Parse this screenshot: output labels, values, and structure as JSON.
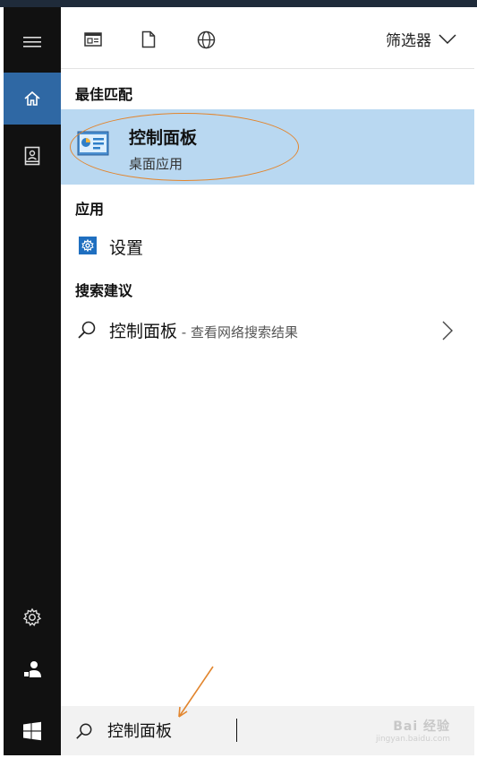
{
  "toolbar": {
    "filter_label": "筛选器",
    "icons": [
      "document-list-icon",
      "file-icon",
      "globe-icon"
    ]
  },
  "sidebar": {
    "items": [
      "hamburger-menu-icon",
      "home-icon",
      "notebook-icon",
      "settings-gear-icon",
      "user-icon"
    ]
  },
  "sections": {
    "best_match": "最佳匹配",
    "apps": "应用",
    "suggestions": "搜索建议"
  },
  "best_match_item": {
    "title": "控制面板",
    "subtitle": "桌面应用"
  },
  "app_item": {
    "label": "设置"
  },
  "suggestion_item": {
    "query": "控制面板",
    "extra": " - 查看网络搜索结果"
  },
  "search": {
    "value": "控制面板"
  },
  "watermark": {
    "text": "Bai 经验",
    "sub": "jingyan.baidu.com"
  },
  "colors": {
    "sidebar_bg": "#111111",
    "home_active": "#2f68a4",
    "best_match_bg": "#b9d8f1",
    "annotation": "#e2852d",
    "settings_icon": "#1f6fc0",
    "searchbar_bg": "#f2f2f2"
  }
}
